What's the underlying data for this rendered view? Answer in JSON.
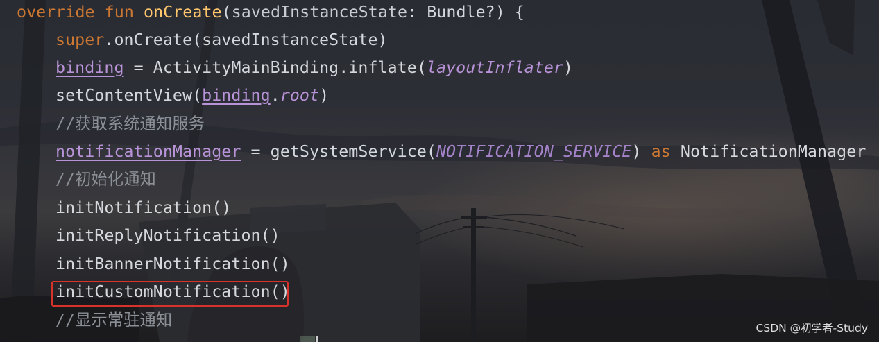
{
  "code": {
    "l1": {
      "kw": "override fun ",
      "fn": "onCreate",
      "open": "(",
      "param": "savedInstanceState",
      "rest": ": Bundle?) {"
    },
    "l2": {
      "kw": "super",
      "rest": ".onCreate(savedInstanceState)"
    },
    "l3": {
      "prop": "binding",
      "mid": " = ActivityMainBinding.inflate(",
      "ital": "layoutInflater",
      "close": ")"
    },
    "l4": {
      "a": "setContentView(",
      "prop": "binding",
      "dot": ".",
      "ital": "root",
      "close": ")"
    },
    "l5": {
      "comment": "//获取系统通知服务"
    },
    "l6": {
      "prop": "notificationManager",
      "mid": " = getSystemService(",
      "const": "NOTIFICATION_SERVICE",
      "close": ") ",
      "kw": "as",
      "type": " NotificationManager"
    },
    "l7": {
      "comment": "//初始化通知"
    },
    "l8": {
      "text": "initNotification()"
    },
    "l9": {
      "text": "initReplyNotification()"
    },
    "l10": {
      "text": "initBannerNotification()"
    },
    "l11": {
      "text": "initCustomNotification()"
    },
    "l12": {
      "comment": "//显示常驻通知"
    }
  },
  "watermark": "CSDN @初学者-Study",
  "colors": {
    "keyword": "#cc7832",
    "function_declaration": "#ffc66d",
    "property": "#b893d8",
    "comment": "#8b8f96",
    "highlight_border": "#d8332a"
  }
}
